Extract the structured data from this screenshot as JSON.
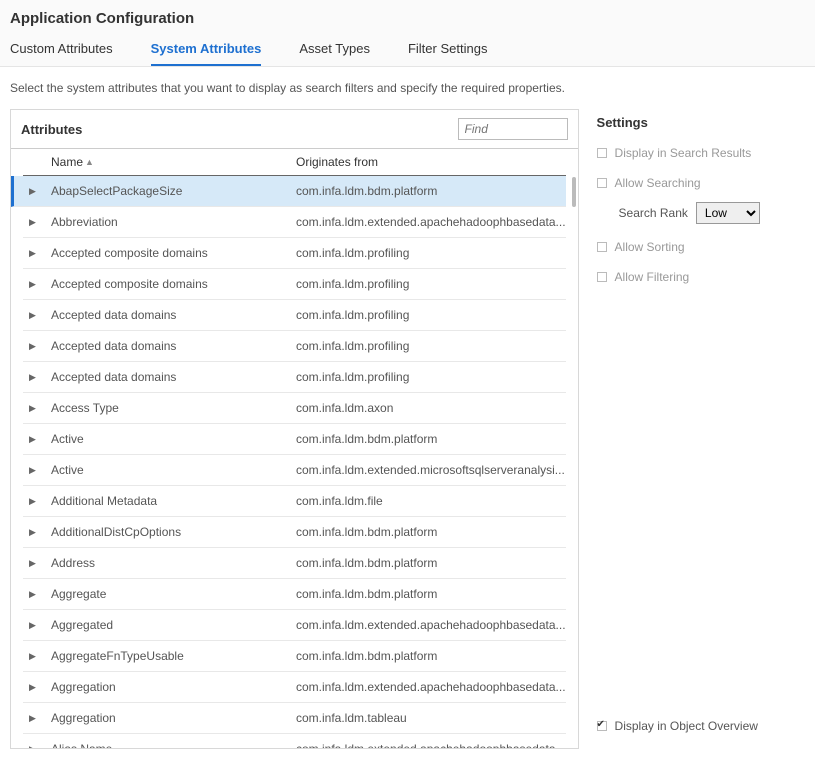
{
  "page_title": "Application Configuration",
  "tabs": [
    {
      "label": "Custom Attributes",
      "active": false
    },
    {
      "label": "System Attributes",
      "active": true
    },
    {
      "label": "Asset Types",
      "active": false
    },
    {
      "label": "Filter Settings",
      "active": false
    }
  ],
  "description": "Select the system attributes that you want to display as search filters and specify the required properties.",
  "attributes_panel": {
    "title": "Attributes",
    "find_placeholder": "Find",
    "col_name": "Name",
    "col_origin": "Originates from",
    "rows": [
      {
        "name": "AbapSelectPackageSize",
        "origin": "com.infa.ldm.bdm.platform",
        "selected": true
      },
      {
        "name": "Abbreviation",
        "origin": "com.infa.ldm.extended.apachehadoophbasedata..."
      },
      {
        "name": "Accepted composite domains",
        "origin": "com.infa.ldm.profiling"
      },
      {
        "name": "Accepted composite domains",
        "origin": "com.infa.ldm.profiling"
      },
      {
        "name": "Accepted data domains",
        "origin": "com.infa.ldm.profiling"
      },
      {
        "name": "Accepted data domains",
        "origin": "com.infa.ldm.profiling"
      },
      {
        "name": "Accepted data domains",
        "origin": "com.infa.ldm.profiling"
      },
      {
        "name": "Access Type",
        "origin": "com.infa.ldm.axon"
      },
      {
        "name": "Active",
        "origin": "com.infa.ldm.bdm.platform"
      },
      {
        "name": "Active",
        "origin": "com.infa.ldm.extended.microsoftsqlserveranalysi..."
      },
      {
        "name": "Additional Metadata",
        "origin": "com.infa.ldm.file"
      },
      {
        "name": "AdditionalDistCpOptions",
        "origin": "com.infa.ldm.bdm.platform"
      },
      {
        "name": "Address",
        "origin": "com.infa.ldm.bdm.platform"
      },
      {
        "name": "Aggregate",
        "origin": "com.infa.ldm.bdm.platform"
      },
      {
        "name": "Aggregated",
        "origin": "com.infa.ldm.extended.apachehadoophbasedata..."
      },
      {
        "name": "AggregateFnTypeUsable",
        "origin": "com.infa.ldm.bdm.platform"
      },
      {
        "name": "Aggregation",
        "origin": "com.infa.ldm.extended.apachehadoophbasedata..."
      },
      {
        "name": "Aggregation",
        "origin": "com.infa.ldm.tableau"
      },
      {
        "name": "Alias Name",
        "origin": "com.infa.ldm.extended.apachehadoophbasedata..."
      }
    ]
  },
  "settings_panel": {
    "title": "Settings",
    "display_search_results": "Display in Search Results",
    "allow_searching": "Allow Searching",
    "search_rank_label": "Search Rank",
    "search_rank_value": "Low",
    "allow_sorting": "Allow Sorting",
    "allow_filtering": "Allow Filtering",
    "display_object_overview": "Display in Object Overview"
  }
}
